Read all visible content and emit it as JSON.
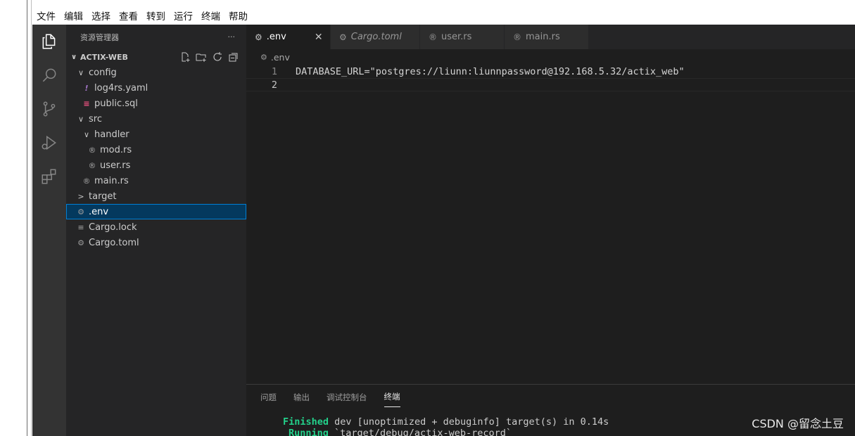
{
  "menu": [
    "文件",
    "编辑",
    "选择",
    "查看",
    "转到",
    "运行",
    "终端",
    "帮助"
  ],
  "sidebar": {
    "title": "资源管理器",
    "more": "···",
    "section": "ACTIX-WEB",
    "tree": [
      {
        "label": "config",
        "twisty": "∨",
        "icon": "",
        "depth": 1
      },
      {
        "label": "log4rs.yaml",
        "twisty": "",
        "icon": "!",
        "depth": 2
      },
      {
        "label": "public.sql",
        "twisty": "",
        "icon": "≡",
        "depth": 2
      },
      {
        "label": "src",
        "twisty": "∨",
        "icon": "",
        "depth": 1
      },
      {
        "label": "handler",
        "twisty": "∨",
        "icon": "",
        "depth": 2
      },
      {
        "label": "mod.rs",
        "twisty": "",
        "icon": "®",
        "depth": 3
      },
      {
        "label": "user.rs",
        "twisty": "",
        "icon": "®",
        "depth": 3
      },
      {
        "label": "main.rs",
        "twisty": "",
        "icon": "®",
        "depth": 2
      },
      {
        "label": "target",
        "twisty": ">",
        "icon": "",
        "depth": 1
      },
      {
        "label": ".env",
        "twisty": "",
        "icon": "⚙",
        "depth": 1,
        "selected": true
      },
      {
        "label": "Cargo.lock",
        "twisty": "",
        "icon": "≡",
        "depth": 1
      },
      {
        "label": "Cargo.toml",
        "twisty": "",
        "icon": "⚙",
        "depth": 1
      }
    ]
  },
  "tabs": [
    {
      "label": ".env",
      "icon": "⚙",
      "active": true,
      "close": "✕"
    },
    {
      "label": "Cargo.toml",
      "icon": "⚙",
      "active": false,
      "italic": true
    },
    {
      "label": "user.rs",
      "icon": "®",
      "active": false
    },
    {
      "label": "main.rs",
      "icon": "®",
      "active": false
    }
  ],
  "breadcrumb": ".env",
  "editor": {
    "lines": [
      {
        "num": "1",
        "text": "DATABASE_URL=\"postgres://liunn:liunnpassword@192.168.5.32/actix_web\""
      },
      {
        "num": "2",
        "text": ""
      }
    ]
  },
  "panel": {
    "tabs": [
      "问题",
      "输出",
      "调试控制台",
      "终端"
    ],
    "active_tab": "终端",
    "terminal": {
      "line1_keyword": "Finished",
      "line1_rest": " dev [unoptimized + debuginfo] target(s) in 0.14s",
      "line2_keyword": "Running",
      "line2_rest": " `target/debug/actix-web-record`"
    }
  },
  "watermark": "CSDN @留念土豆",
  "colors": {
    "activity_bar": "#333333",
    "sidebar_bg": "#252526",
    "editor_bg": "#1e1e1e",
    "selection": "#04395e",
    "focus_border": "#007fd4",
    "yaml_icon": "#a074c4",
    "sql_icon": "#f55385",
    "terminal_green": "#23d18b"
  }
}
